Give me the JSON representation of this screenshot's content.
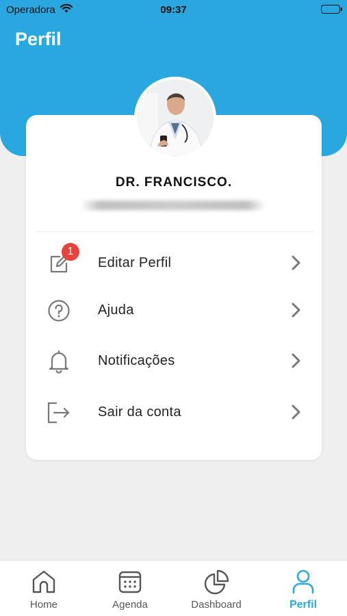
{
  "status_bar": {
    "carrier": "Operadora",
    "time": "09:37"
  },
  "header": {
    "title": "Perfil"
  },
  "profile": {
    "name": "DR. FRANCISCO."
  },
  "menu": [
    {
      "label": "Editar Perfil",
      "icon": "edit-icon",
      "badge": "1"
    },
    {
      "label": "Ajuda",
      "icon": "help-icon"
    },
    {
      "label": "Notificações",
      "icon": "bell-icon"
    },
    {
      "label": "Sair da conta",
      "icon": "logout-icon"
    }
  ],
  "tabbar": {
    "tabs": [
      {
        "label": "Home",
        "icon": "home-icon"
      },
      {
        "label": "Agenda",
        "icon": "calendar-icon"
      },
      {
        "label": "Dashboard",
        "icon": "pie-chart-icon"
      },
      {
        "label": "Perfil",
        "icon": "user-icon",
        "active": true
      }
    ]
  },
  "colors": {
    "accent": "#29a8e0",
    "badge": "#e9423a",
    "background": "#efefef"
  }
}
